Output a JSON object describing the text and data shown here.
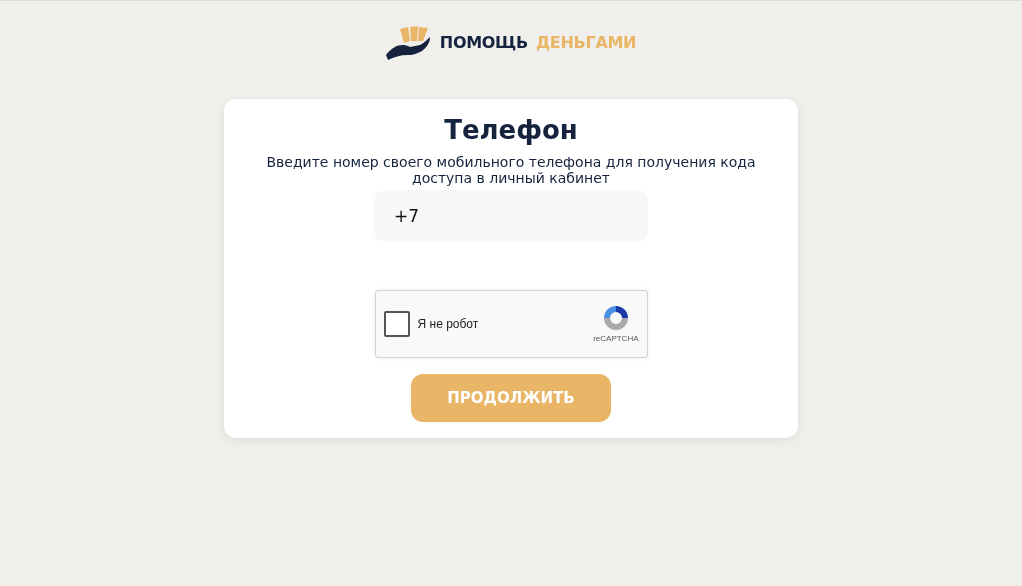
{
  "logo": {
    "word_1": "ПОМОЩЬ",
    "word_2": "ДЕНЬГАМИ"
  },
  "card": {
    "title": "Телефон",
    "description": "Введите номер своего мобильного телефона для получения кода доступа в личный кабинет",
    "phone": {
      "value": "+7"
    },
    "captcha": {
      "label": "Я не робот",
      "brand": "reCAPTCHA",
      "checked": false
    },
    "button": "ПРОДОЛЖИТЬ"
  }
}
